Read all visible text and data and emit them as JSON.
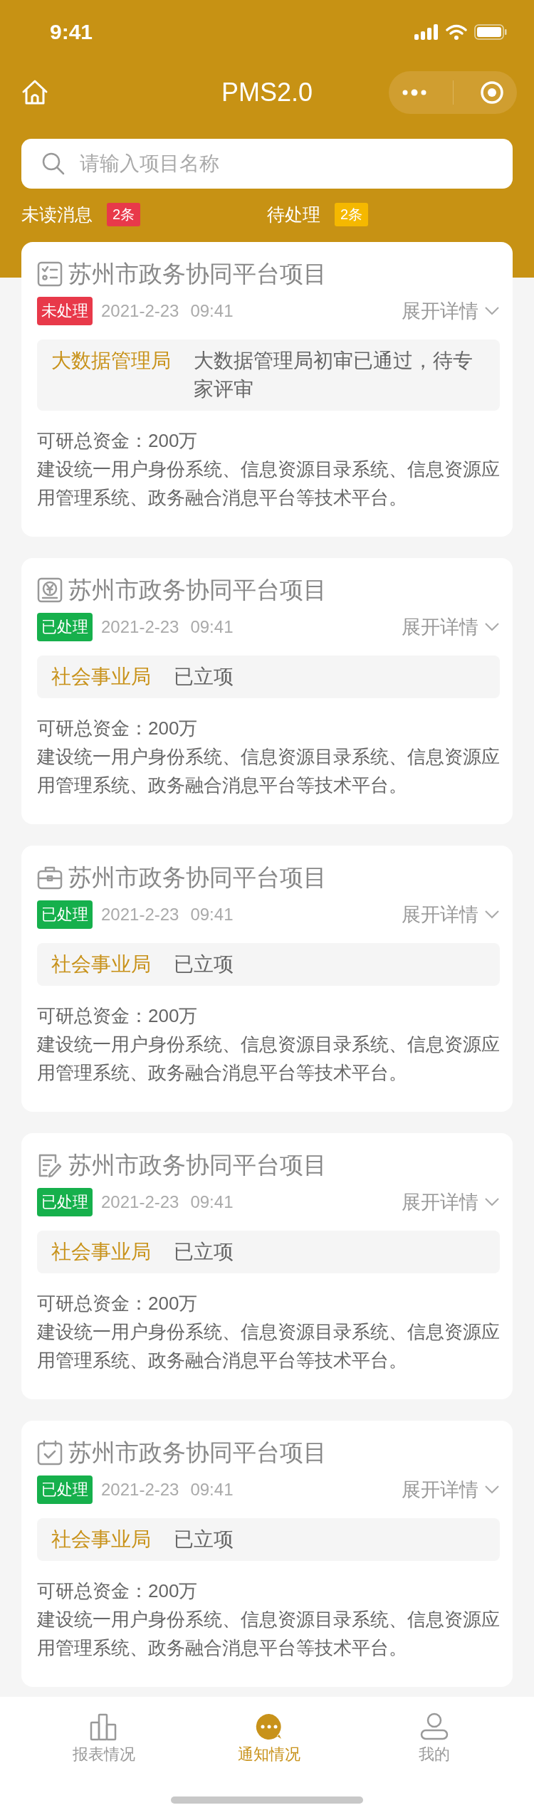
{
  "status_bar": {
    "time": "9:41"
  },
  "nav": {
    "title": "PMS2.0"
  },
  "search": {
    "placeholder": "请输入项目名称"
  },
  "counters": [
    {
      "label": "未读消息",
      "count": "2条",
      "color": "#e8394a"
    },
    {
      "label": "待处理",
      "count": "2条",
      "color": "#f5b800"
    }
  ],
  "cards": [
    {
      "kind": "checklist",
      "title": "苏州市政务协同平台项目",
      "status": "未处理",
      "processed": false,
      "date": "2021-2-23",
      "time": "09:41",
      "toggle": "展开详情",
      "department": "大数据管理局",
      "message": "大数据管理局初审已通过，待专家评审",
      "funding": "可研总资金：200万",
      "description": "建设统一用户身份系统、信息资源目录系统、信息资源应用管理系统、政务融合消息平台等技术平台。"
    },
    {
      "kind": "yen",
      "title": "苏州市政务协同平台项目",
      "status": "已处理",
      "processed": true,
      "date": "2021-2-23",
      "time": "09:41",
      "toggle": "展开详情",
      "department": "社会事业局",
      "message": "已立项",
      "funding": "可研总资金：200万",
      "description": "建设统一用户身份系统、信息资源目录系统、信息资源应用管理系统、政务融合消息平台等技术平台。"
    },
    {
      "kind": "briefcase",
      "title": "苏州市政务协同平台项目",
      "status": "已处理",
      "processed": true,
      "date": "2021-2-23",
      "time": "09:41",
      "toggle": "展开详情",
      "department": "社会事业局",
      "message": "已立项",
      "funding": "可研总资金：200万",
      "description": "建设统一用户身份系统、信息资源目录系统、信息资源应用管理系统、政务融合消息平台等技术平台。"
    },
    {
      "kind": "edit",
      "title": "苏州市政务协同平台项目",
      "status": "已处理",
      "processed": true,
      "date": "2021-2-23",
      "time": "09:41",
      "toggle": "展开详情",
      "department": "社会事业局",
      "message": "已立项",
      "funding": "可研总资金：200万",
      "description": "建设统一用户身份系统、信息资源目录系统、信息资源应用管理系统、政务融合消息平台等技术平台。"
    },
    {
      "kind": "calendar",
      "title": "苏州市政务协同平台项目",
      "status": "已处理",
      "processed": true,
      "date": "2021-2-23",
      "time": "09:41",
      "toggle": "展开详情",
      "department": "社会事业局",
      "message": "已立项",
      "funding": "可研总资金：200万",
      "description": "建设统一用户身份系统、信息资源目录系统、信息资源应用管理系统、政务融合消息平台等技术平台。"
    }
  ],
  "tab_bar": [
    {
      "kind": "chart",
      "label": "报表情况",
      "selected": false
    },
    {
      "kind": "chat",
      "label": "通知情况",
      "selected": true
    },
    {
      "kind": "person",
      "label": "我的",
      "selected": false
    }
  ]
}
